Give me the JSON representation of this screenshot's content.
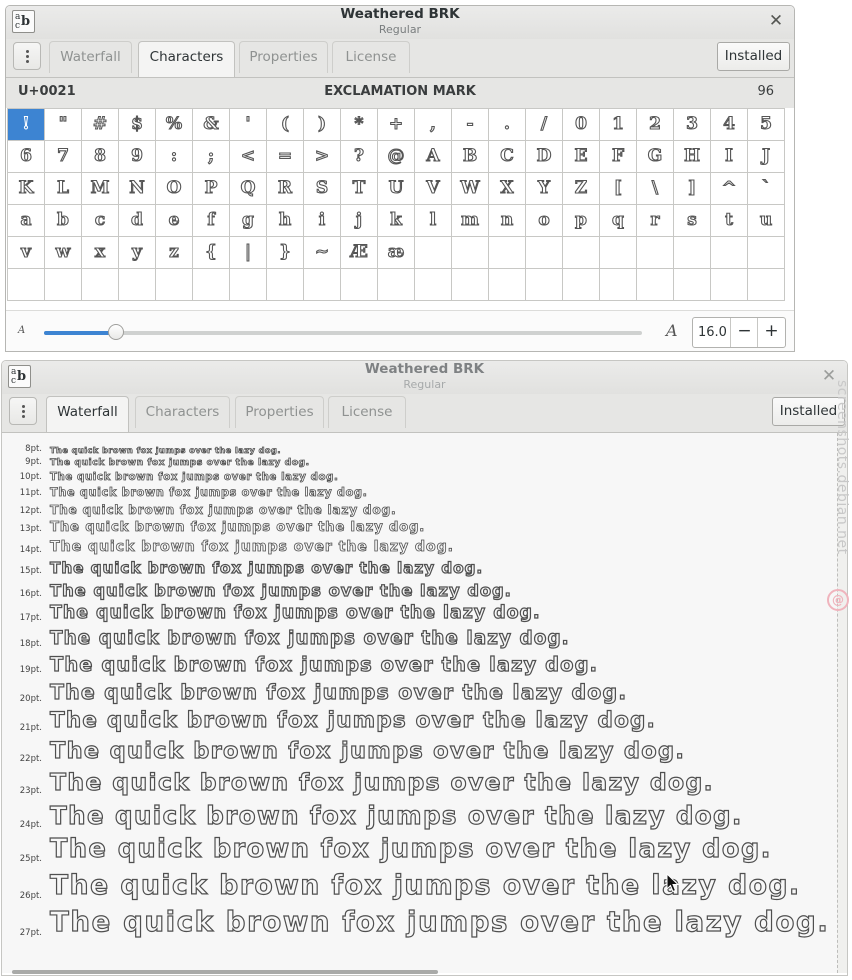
{
  "window1": {
    "title": "Weathered BRK",
    "subtitle": "Regular",
    "tabs": [
      "Waterfall",
      "Characters",
      "Properties",
      "License"
    ],
    "active_tab": "Characters",
    "installed_label": "Installed",
    "info": {
      "codepoint": "U+0021",
      "name": "EXCLAMATION MARK",
      "count": "96"
    },
    "characters": [
      [
        "!",
        "\"",
        "#",
        "$",
        "%",
        "&",
        "'",
        "(",
        ")",
        "*",
        "+",
        ",",
        "-",
        ".",
        "/",
        "0",
        "1",
        "2",
        "3",
        "4",
        "5"
      ],
      [
        "6",
        "7",
        "8",
        "9",
        ":",
        ";",
        "<",
        "=",
        ">",
        "?",
        "@",
        "A",
        "B",
        "C",
        "D",
        "E",
        "F",
        "G",
        "H",
        "I",
        "J"
      ],
      [
        "K",
        "L",
        "M",
        "N",
        "O",
        "P",
        "Q",
        "R",
        "S",
        "T",
        "U",
        "V",
        "W",
        "X",
        "Y",
        "Z",
        "[",
        "\\",
        "]",
        "^",
        "`"
      ],
      [
        "a",
        "b",
        "c",
        "d",
        "e",
        "f",
        "g",
        "h",
        "i",
        "j",
        "k",
        "l",
        "m",
        "n",
        "o",
        "p",
        "q",
        "r",
        "s",
        "t",
        "u"
      ],
      [
        "v",
        "w",
        "x",
        "y",
        "z",
        "{",
        "|",
        "}",
        "~",
        "Æ",
        "æ",
        "",
        "",
        "",
        "",
        "",
        "",
        "",
        "",
        "",
        ""
      ],
      [
        "",
        "",
        "",
        "",
        "",
        "",
        "",
        "",
        "",
        "",
        "",
        "",
        "",
        "",
        "",
        "",
        "",
        "",
        "",
        "",
        ""
      ]
    ],
    "selected_char": "!",
    "slider_fraction": 0.12,
    "size_value": "16.0",
    "minus_label": "−",
    "plus_label": "+",
    "size_small_glyph": "A",
    "size_large_glyph": "A"
  },
  "window2": {
    "title": "Weathered BRK",
    "subtitle": "Regular",
    "tabs": [
      "Waterfall",
      "Characters",
      "Properties",
      "License"
    ],
    "active_tab": "Waterfall",
    "installed_label": "Installed",
    "sample_text": "The quick brown fox jumps over the lazy dog.",
    "sizes": [
      "8pt.",
      "9pt.",
      "10pt.",
      "11pt.",
      "12pt.",
      "13pt.",
      "14pt.",
      "15pt.",
      "16pt.",
      "17pt.",
      "18pt.",
      "19pt.",
      "20pt.",
      "21pt.",
      "22pt.",
      "23pt.",
      "24pt.",
      "25pt.",
      "26pt.",
      "27pt."
    ]
  },
  "watermark": "screenshots.debian.net",
  "icons": {
    "app": "font-viewer-icon",
    "close": "close-icon",
    "menu": "vertical-dots-menu-icon",
    "pointer": "mouse-pointer-icon"
  },
  "colors": {
    "accent": "#3d84d2",
    "titlebar": "#e6e6e4",
    "waterfall_bg": "#f7f7f7"
  }
}
